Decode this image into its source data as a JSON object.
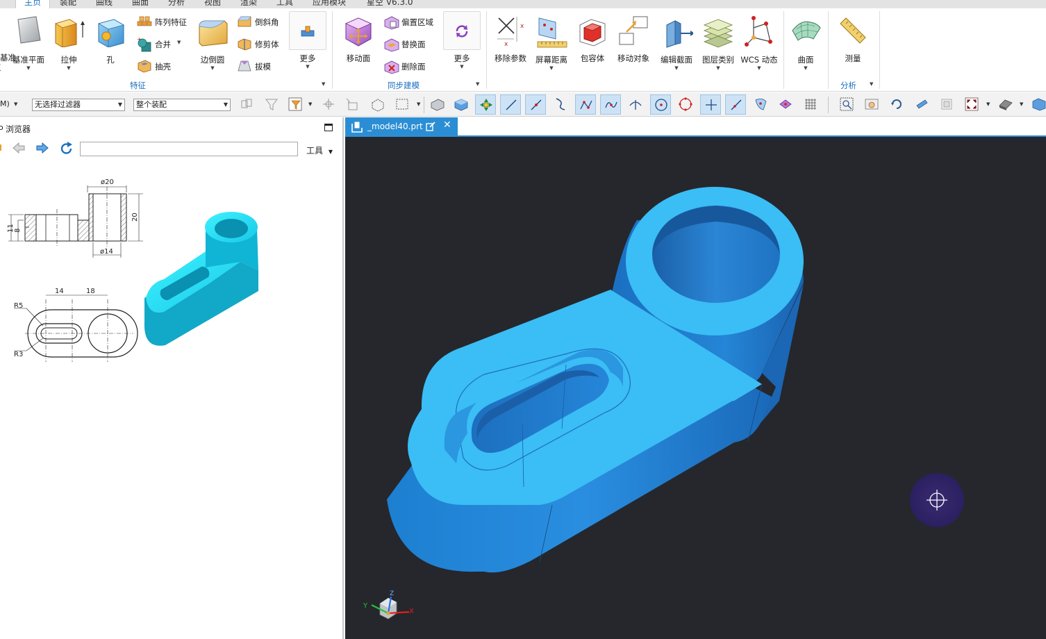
{
  "tabs": [
    "主页",
    "装配",
    "曲线",
    "曲面",
    "分析",
    "视图",
    "渲染",
    "工具",
    "应用模块",
    "星空 V6.3.0"
  ],
  "ribbon": {
    "cut_left_label_1": "基准",
    "cut_left_label_2": "点",
    "features": {
      "datum_plane": "基准平面",
      "extrude": "拉伸",
      "hole": "孔",
      "pattern": "阵列特征",
      "unite": "合并",
      "shell": "抽壳",
      "edge_blend": "边倒圆",
      "chamfer": "倒斜角",
      "trim_body": "修剪体",
      "draft": "拔模",
      "more": "更多",
      "group_label": "特征"
    },
    "sync": {
      "move_face": "移动面",
      "offset_region": "偏置区域",
      "replace_face": "替换面",
      "delete_face": "删除面",
      "more": "更多",
      "group_label": "同步建模"
    },
    "tools": {
      "remove_params": "移除参数",
      "screen_distance": "屏幕距离",
      "bounding_body": "包容体",
      "move_object": "移动对象",
      "edit_section": "编辑截面",
      "layer_category": "图层类别",
      "wcs_dynamic": "WCS 动态",
      "surface": "曲面",
      "measure": "测量",
      "group_label": "分析"
    }
  },
  "toolbar": {
    "menu_cut": "M)",
    "filter": "无选择过滤器",
    "scope": "整个装配"
  },
  "browser": {
    "title": "浏览器",
    "url": "",
    "tools_menu": "工具",
    "drawing": {
      "dim_d20": "ø20",
      "dim_d14": "ø14",
      "dim_20": "20",
      "dim_11": "11",
      "dim_8": "8",
      "dim_14": "14",
      "dim_18": "18",
      "dim_r5": "R5",
      "dim_r3": "R3"
    }
  },
  "document": {
    "tab_name": "_model40.prt"
  },
  "viewport": {
    "background": "#25272c",
    "part_color": "#3bbdf5",
    "part_shadow": "#1f6fb8",
    "triad_x": "X",
    "triad_y": "Y",
    "triad_z": "Z"
  }
}
